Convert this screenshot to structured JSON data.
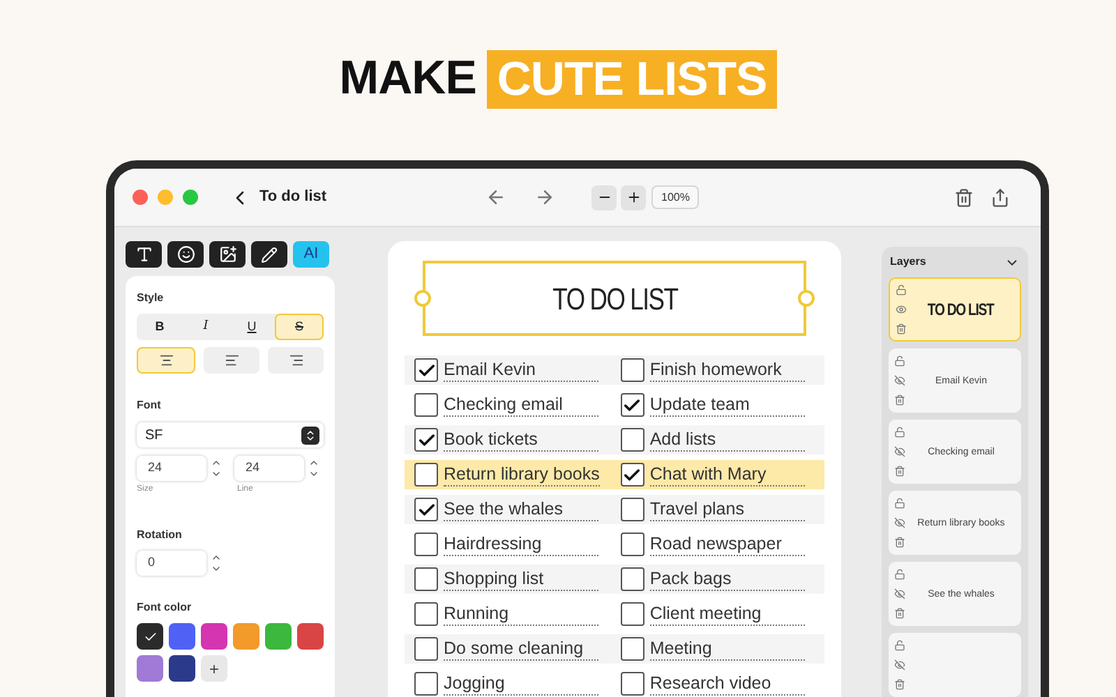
{
  "headline": {
    "plain": "MAKE",
    "highlight": "CUTE LISTS"
  },
  "window": {
    "title": "To do list",
    "zoom": "100%"
  },
  "tools": [
    {
      "kind": "text",
      "selected": false
    },
    {
      "kind": "emoji",
      "selected": false
    },
    {
      "kind": "image",
      "selected": false
    },
    {
      "kind": "pencil",
      "selected": false
    },
    {
      "kind": "ai",
      "label": "AI",
      "selected": true
    }
  ],
  "style_panel": {
    "style_label": "Style",
    "style_buttons": [
      {
        "label": "B",
        "kind": "bold",
        "selected": false
      },
      {
        "label": "I",
        "kind": "italic",
        "selected": false
      },
      {
        "label": "U",
        "kind": "underline",
        "selected": false
      },
      {
        "label": "S",
        "kind": "strike",
        "selected": true
      }
    ],
    "alignment": [
      {
        "kind": "center",
        "selected": true
      },
      {
        "kind": "left",
        "selected": false
      },
      {
        "kind": "right",
        "selected": false
      }
    ],
    "font_label": "Font",
    "font_value": "SF",
    "size": {
      "value": "24",
      "caption": "Size"
    },
    "line": {
      "value": "24",
      "caption": "Line"
    },
    "rotation_label": "Rotation",
    "rotation_value": "0",
    "color_label": "Font color",
    "font_colors": [
      {
        "color": "#2b2b2b",
        "selected": true
      },
      {
        "color": "#4f62f5",
        "selected": false
      },
      {
        "color": "#d535b0",
        "selected": false
      },
      {
        "color": "#f29a2a",
        "selected": false
      },
      {
        "color": "#3cb83e",
        "selected": false
      },
      {
        "color": "#d94545",
        "selected": false
      },
      {
        "color": "#a07ad6",
        "selected": false
      },
      {
        "color": "#2c3a8c",
        "selected": false
      }
    ],
    "add_color": "+"
  },
  "list": {
    "title": "TO DO LIST",
    "rows": [
      {
        "selected": false,
        "items": [
          {
            "label": "Email Kevin",
            "checked": true
          },
          {
            "label": "Finish homework",
            "checked": false
          }
        ]
      },
      {
        "selected": false,
        "items": [
          {
            "label": "Checking email",
            "checked": false
          },
          {
            "label": "Update team",
            "checked": true
          }
        ]
      },
      {
        "selected": false,
        "items": [
          {
            "label": "Book tickets",
            "checked": true
          },
          {
            "label": "Add lists",
            "checked": false
          }
        ]
      },
      {
        "selected": true,
        "items": [
          {
            "label": "Return library books",
            "checked": false
          },
          {
            "label": "Chat with Mary",
            "checked": true
          }
        ]
      },
      {
        "selected": false,
        "items": [
          {
            "label": "See the whales",
            "checked": true
          },
          {
            "label": "Travel plans",
            "checked": false
          }
        ]
      },
      {
        "selected": false,
        "items": [
          {
            "label": "Hairdressing",
            "checked": false
          },
          {
            "label": "Road newspaper",
            "checked": false
          }
        ]
      },
      {
        "selected": false,
        "items": [
          {
            "label": "Shopping list",
            "checked": false
          },
          {
            "label": "Pack bags",
            "checked": false
          }
        ]
      },
      {
        "selected": false,
        "items": [
          {
            "label": "Running",
            "checked": false
          },
          {
            "label": "Client meeting",
            "checked": false
          }
        ]
      },
      {
        "selected": false,
        "items": [
          {
            "label": "Do some cleaning",
            "checked": false
          },
          {
            "label": "Meeting",
            "checked": false
          }
        ]
      },
      {
        "selected": false,
        "items": [
          {
            "label": "Jogging",
            "checked": false
          },
          {
            "label": "Research video",
            "checked": false
          }
        ]
      }
    ]
  },
  "layers": {
    "title": "Layers",
    "items": [
      {
        "label": "TO DO LIST",
        "kind": "title",
        "selected": true,
        "visible": true
      },
      {
        "label": "Email Kevin",
        "kind": "text",
        "selected": false,
        "visible": false
      },
      {
        "label": "Checking email",
        "kind": "text",
        "selected": false,
        "visible": false
      },
      {
        "label": "Return library books",
        "kind": "text",
        "selected": false,
        "visible": false
      },
      {
        "label": "See the whales",
        "kind": "text",
        "selected": false,
        "visible": false
      },
      {
        "kind": "text",
        "selected": false,
        "visible": false
      }
    ]
  }
}
